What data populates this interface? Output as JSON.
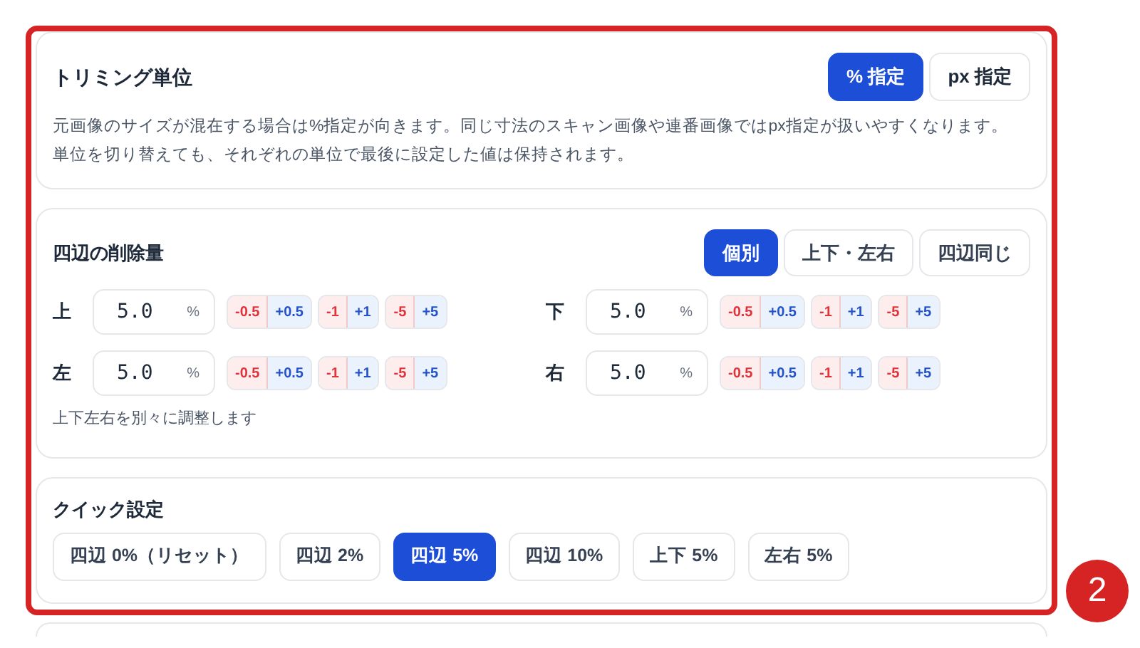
{
  "unit": {
    "title": "トリミング単位",
    "options": [
      {
        "label": "% 指定",
        "selected": true
      },
      {
        "label": "px 指定",
        "selected": false
      }
    ],
    "description": "元画像のサイズが混在する場合は%指定が向きます。同じ寸法のスキャン画像や連番画像ではpx指定が扱いやすくなります。単位を切り替えても、それぞれの単位で最後に設定した値は保持されます。"
  },
  "edges": {
    "title": "四辺の削除量",
    "modes": [
      {
        "label": "個別",
        "selected": true
      },
      {
        "label": "上下・左右",
        "selected": false
      },
      {
        "label": "四辺同じ",
        "selected": false
      }
    ],
    "fields": [
      {
        "label": "上",
        "value": "5.0",
        "unit": "%",
        "steps": [
          {
            "minus": "-0.5",
            "plus": "+0.5"
          },
          {
            "minus": "-1",
            "plus": "+1"
          },
          {
            "minus": "-5",
            "plus": "+5"
          }
        ]
      },
      {
        "label": "下",
        "value": "5.0",
        "unit": "%",
        "steps": [
          {
            "minus": "-0.5",
            "plus": "+0.5"
          },
          {
            "minus": "-1",
            "plus": "+1"
          },
          {
            "minus": "-5",
            "plus": "+5"
          }
        ]
      },
      {
        "label": "左",
        "value": "5.0",
        "unit": "%",
        "steps": [
          {
            "minus": "-0.5",
            "plus": "+0.5"
          },
          {
            "minus": "-1",
            "plus": "+1"
          },
          {
            "minus": "-5",
            "plus": "+5"
          }
        ]
      },
      {
        "label": "右",
        "value": "5.0",
        "unit": "%",
        "steps": [
          {
            "minus": "-0.5",
            "plus": "+0.5"
          },
          {
            "minus": "-1",
            "plus": "+1"
          },
          {
            "minus": "-5",
            "plus": "+5"
          }
        ]
      }
    ],
    "hint": "上下左右を別々に調整します"
  },
  "quick": {
    "title": "クイック設定",
    "presets": [
      {
        "label": "四辺 0%（リセット）",
        "selected": false
      },
      {
        "label": "四辺 2%",
        "selected": false
      },
      {
        "label": "四辺 5%",
        "selected": true
      },
      {
        "label": "四辺 10%",
        "selected": false
      },
      {
        "label": "上下 5%",
        "selected": false
      },
      {
        "label": "左右 5%",
        "selected": false
      }
    ]
  },
  "annotation": {
    "number": "2"
  }
}
